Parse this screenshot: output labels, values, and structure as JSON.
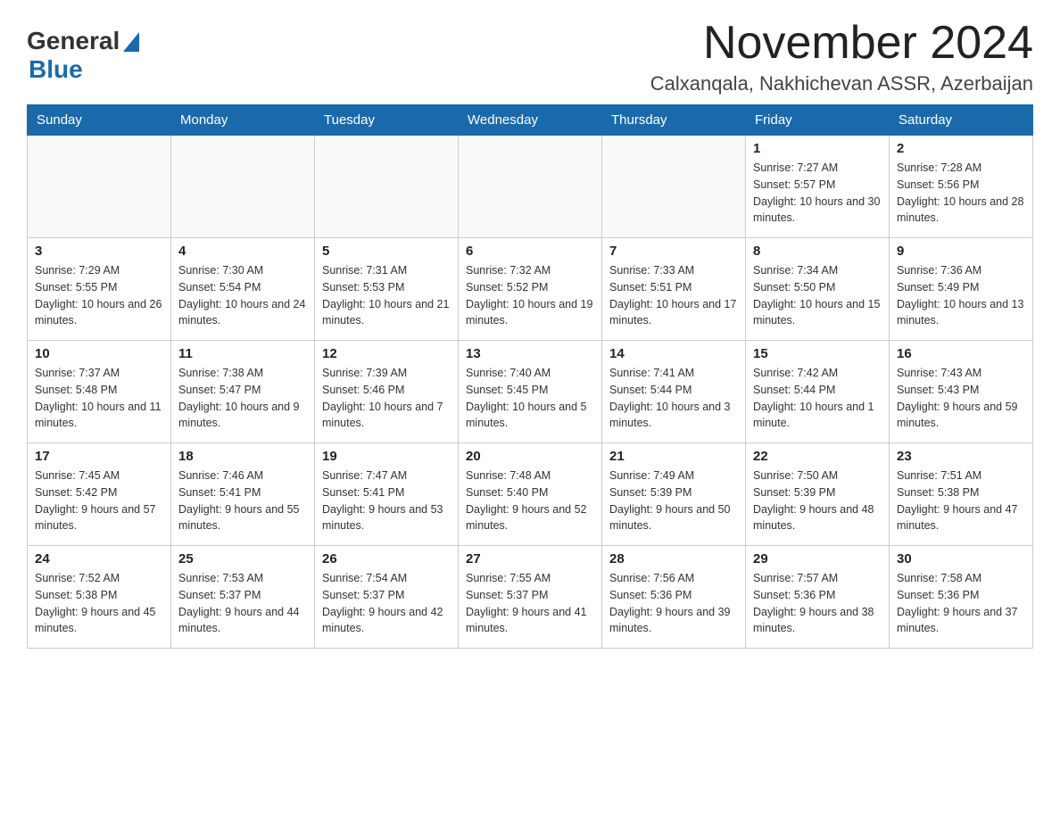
{
  "header": {
    "logo_general": "General",
    "logo_blue": "Blue",
    "month_title": "November 2024",
    "location": "Calxanqala, Nakhichevan ASSR, Azerbaijan"
  },
  "days_of_week": [
    "Sunday",
    "Monday",
    "Tuesday",
    "Wednesday",
    "Thursday",
    "Friday",
    "Saturday"
  ],
  "weeks": [
    [
      {
        "day": "",
        "sunrise": "",
        "sunset": "",
        "daylight": ""
      },
      {
        "day": "",
        "sunrise": "",
        "sunset": "",
        "daylight": ""
      },
      {
        "day": "",
        "sunrise": "",
        "sunset": "",
        "daylight": ""
      },
      {
        "day": "",
        "sunrise": "",
        "sunset": "",
        "daylight": ""
      },
      {
        "day": "",
        "sunrise": "",
        "sunset": "",
        "daylight": ""
      },
      {
        "day": "1",
        "sunrise": "Sunrise: 7:27 AM",
        "sunset": "Sunset: 5:57 PM",
        "daylight": "Daylight: 10 hours and 30 minutes."
      },
      {
        "day": "2",
        "sunrise": "Sunrise: 7:28 AM",
        "sunset": "Sunset: 5:56 PM",
        "daylight": "Daylight: 10 hours and 28 minutes."
      }
    ],
    [
      {
        "day": "3",
        "sunrise": "Sunrise: 7:29 AM",
        "sunset": "Sunset: 5:55 PM",
        "daylight": "Daylight: 10 hours and 26 minutes."
      },
      {
        "day": "4",
        "sunrise": "Sunrise: 7:30 AM",
        "sunset": "Sunset: 5:54 PM",
        "daylight": "Daylight: 10 hours and 24 minutes."
      },
      {
        "day": "5",
        "sunrise": "Sunrise: 7:31 AM",
        "sunset": "Sunset: 5:53 PM",
        "daylight": "Daylight: 10 hours and 21 minutes."
      },
      {
        "day": "6",
        "sunrise": "Sunrise: 7:32 AM",
        "sunset": "Sunset: 5:52 PM",
        "daylight": "Daylight: 10 hours and 19 minutes."
      },
      {
        "day": "7",
        "sunrise": "Sunrise: 7:33 AM",
        "sunset": "Sunset: 5:51 PM",
        "daylight": "Daylight: 10 hours and 17 minutes."
      },
      {
        "day": "8",
        "sunrise": "Sunrise: 7:34 AM",
        "sunset": "Sunset: 5:50 PM",
        "daylight": "Daylight: 10 hours and 15 minutes."
      },
      {
        "day": "9",
        "sunrise": "Sunrise: 7:36 AM",
        "sunset": "Sunset: 5:49 PM",
        "daylight": "Daylight: 10 hours and 13 minutes."
      }
    ],
    [
      {
        "day": "10",
        "sunrise": "Sunrise: 7:37 AM",
        "sunset": "Sunset: 5:48 PM",
        "daylight": "Daylight: 10 hours and 11 minutes."
      },
      {
        "day": "11",
        "sunrise": "Sunrise: 7:38 AM",
        "sunset": "Sunset: 5:47 PM",
        "daylight": "Daylight: 10 hours and 9 minutes."
      },
      {
        "day": "12",
        "sunrise": "Sunrise: 7:39 AM",
        "sunset": "Sunset: 5:46 PM",
        "daylight": "Daylight: 10 hours and 7 minutes."
      },
      {
        "day": "13",
        "sunrise": "Sunrise: 7:40 AM",
        "sunset": "Sunset: 5:45 PM",
        "daylight": "Daylight: 10 hours and 5 minutes."
      },
      {
        "day": "14",
        "sunrise": "Sunrise: 7:41 AM",
        "sunset": "Sunset: 5:44 PM",
        "daylight": "Daylight: 10 hours and 3 minutes."
      },
      {
        "day": "15",
        "sunrise": "Sunrise: 7:42 AM",
        "sunset": "Sunset: 5:44 PM",
        "daylight": "Daylight: 10 hours and 1 minute."
      },
      {
        "day": "16",
        "sunrise": "Sunrise: 7:43 AM",
        "sunset": "Sunset: 5:43 PM",
        "daylight": "Daylight: 9 hours and 59 minutes."
      }
    ],
    [
      {
        "day": "17",
        "sunrise": "Sunrise: 7:45 AM",
        "sunset": "Sunset: 5:42 PM",
        "daylight": "Daylight: 9 hours and 57 minutes."
      },
      {
        "day": "18",
        "sunrise": "Sunrise: 7:46 AM",
        "sunset": "Sunset: 5:41 PM",
        "daylight": "Daylight: 9 hours and 55 minutes."
      },
      {
        "day": "19",
        "sunrise": "Sunrise: 7:47 AM",
        "sunset": "Sunset: 5:41 PM",
        "daylight": "Daylight: 9 hours and 53 minutes."
      },
      {
        "day": "20",
        "sunrise": "Sunrise: 7:48 AM",
        "sunset": "Sunset: 5:40 PM",
        "daylight": "Daylight: 9 hours and 52 minutes."
      },
      {
        "day": "21",
        "sunrise": "Sunrise: 7:49 AM",
        "sunset": "Sunset: 5:39 PM",
        "daylight": "Daylight: 9 hours and 50 minutes."
      },
      {
        "day": "22",
        "sunrise": "Sunrise: 7:50 AM",
        "sunset": "Sunset: 5:39 PM",
        "daylight": "Daylight: 9 hours and 48 minutes."
      },
      {
        "day": "23",
        "sunrise": "Sunrise: 7:51 AM",
        "sunset": "Sunset: 5:38 PM",
        "daylight": "Daylight: 9 hours and 47 minutes."
      }
    ],
    [
      {
        "day": "24",
        "sunrise": "Sunrise: 7:52 AM",
        "sunset": "Sunset: 5:38 PM",
        "daylight": "Daylight: 9 hours and 45 minutes."
      },
      {
        "day": "25",
        "sunrise": "Sunrise: 7:53 AM",
        "sunset": "Sunset: 5:37 PM",
        "daylight": "Daylight: 9 hours and 44 minutes."
      },
      {
        "day": "26",
        "sunrise": "Sunrise: 7:54 AM",
        "sunset": "Sunset: 5:37 PM",
        "daylight": "Daylight: 9 hours and 42 minutes."
      },
      {
        "day": "27",
        "sunrise": "Sunrise: 7:55 AM",
        "sunset": "Sunset: 5:37 PM",
        "daylight": "Daylight: 9 hours and 41 minutes."
      },
      {
        "day": "28",
        "sunrise": "Sunrise: 7:56 AM",
        "sunset": "Sunset: 5:36 PM",
        "daylight": "Daylight: 9 hours and 39 minutes."
      },
      {
        "day": "29",
        "sunrise": "Sunrise: 7:57 AM",
        "sunset": "Sunset: 5:36 PM",
        "daylight": "Daylight: 9 hours and 38 minutes."
      },
      {
        "day": "30",
        "sunrise": "Sunrise: 7:58 AM",
        "sunset": "Sunset: 5:36 PM",
        "daylight": "Daylight: 9 hours and 37 minutes."
      }
    ]
  ]
}
